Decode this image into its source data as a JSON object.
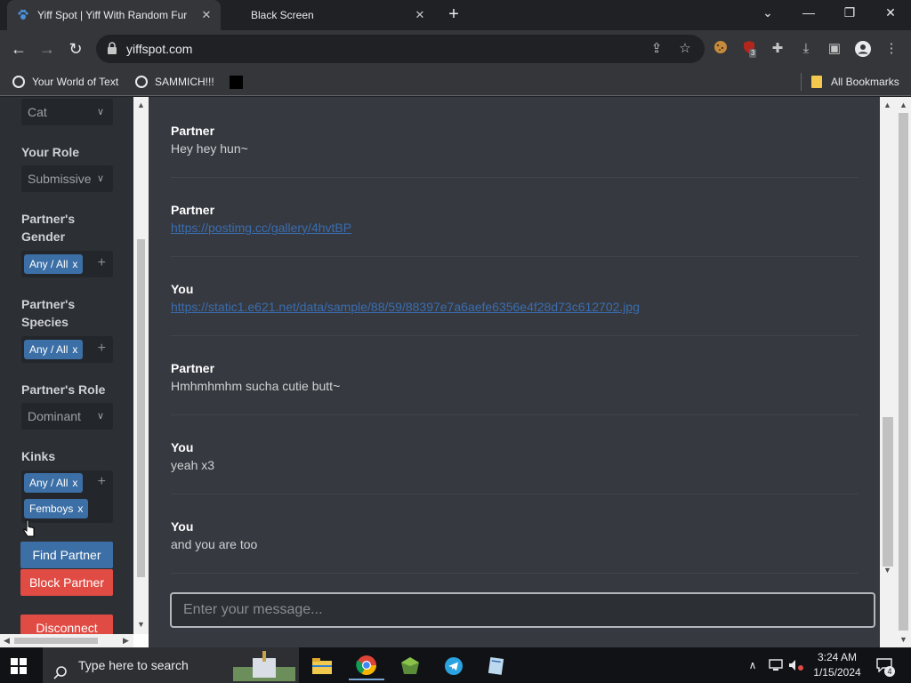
{
  "browser": {
    "tabs": [
      {
        "title": "Yiff Spot | Yiff With Random Fur",
        "active": true
      },
      {
        "title": "Black Screen",
        "active": false
      }
    ],
    "url": "yiffspot.com",
    "bookmarks": [
      {
        "label": "Your World of Text",
        "icon": "globe-icon"
      },
      {
        "label": "SAMMICH!!!",
        "icon": "globe-icon"
      }
    ],
    "all_bookmarks_label": "All Bookmarks",
    "extension_badge": "3"
  },
  "sidebar": {
    "species_value": "Cat",
    "your_role_label": "Your Role",
    "your_role_value": "Submissive",
    "partner_gender_label": "Partner's Gender",
    "partner_gender_tag": "Any / All",
    "partner_species_label": "Partner's Species",
    "partner_species_tag": "Any / All",
    "partner_role_label": "Partner's Role",
    "partner_role_value": "Dominant",
    "kinks_label": "Kinks",
    "kinks_tags": [
      "Any / All",
      "Femboys"
    ],
    "tag_remove": "x",
    "find_button": "Find Partner",
    "block_button": "Block Partner",
    "disconnect_button": "Disconnect"
  },
  "chat": {
    "messages": [
      {
        "sender": "Partner",
        "text": "Hey hey hun~",
        "is_link": false
      },
      {
        "sender": "Partner",
        "text": "https://postimg.cc/gallery/4hvtBP",
        "is_link": true
      },
      {
        "sender": "You",
        "text": "https://static1.e621.net/data/sample/88/59/88397e7a6aefe6356e4f28d73c612702.jpg",
        "is_link": true
      },
      {
        "sender": "Partner",
        "text": "Hmhmhmhm sucha cutie butt~",
        "is_link": false
      },
      {
        "sender": "You",
        "text": "yeah x3",
        "is_link": false
      },
      {
        "sender": "You",
        "text": "and you are too",
        "is_link": false
      }
    ],
    "input_placeholder": "Enter your message..."
  },
  "taskbar": {
    "search_placeholder": "Type here to search",
    "time": "3:24 AM",
    "date": "1/15/2024",
    "notification_count": "4"
  },
  "colors": {
    "chat_bg": "#36393f",
    "sidebar_bg": "#2c2f33",
    "tag_blue": "#3c6fa6",
    "button_red": "#e04b44"
  }
}
